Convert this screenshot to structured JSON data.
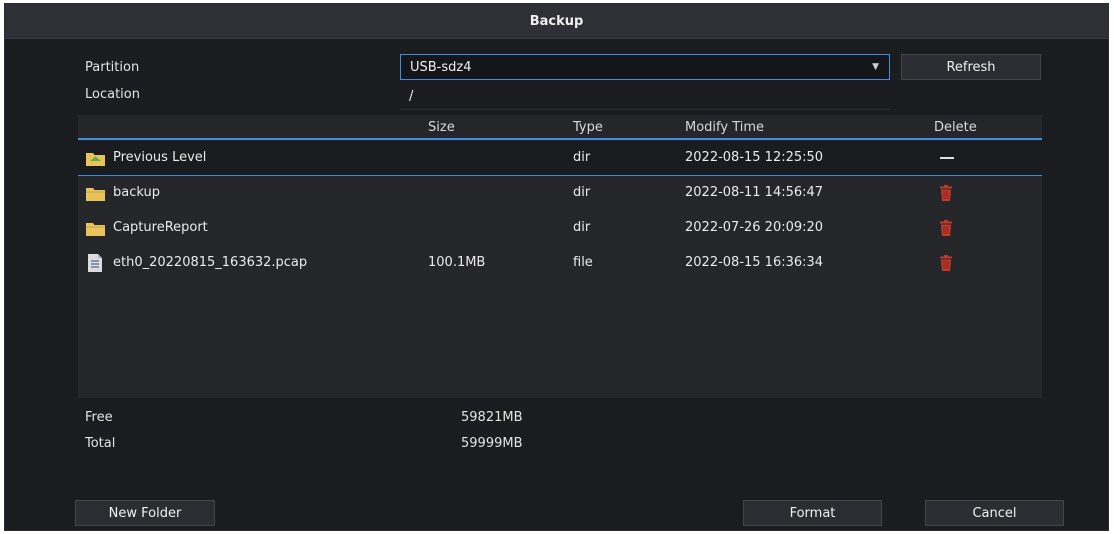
{
  "window": {
    "title": "Backup"
  },
  "form": {
    "partition_label": "Partition",
    "partition_value": "USB-sdz4",
    "location_label": "Location",
    "location_value": "/",
    "refresh_button": "Refresh"
  },
  "table": {
    "columns": [
      "",
      "Size",
      "Type",
      "Modify Time",
      "Delete"
    ],
    "rows": [
      {
        "name": "Previous Level",
        "size": "",
        "type": "dir",
        "time": "2022-08-15 12:25:50",
        "icon": "folder-up-icon",
        "delete": "dash-icon"
      },
      {
        "name": "backup",
        "size": "",
        "type": "dir",
        "time": "2022-08-11 14:56:47",
        "icon": "folder-icon",
        "delete": "trash-icon"
      },
      {
        "name": "CaptureReport",
        "size": "",
        "type": "dir",
        "time": "2022-07-26 20:09:20",
        "icon": "folder-icon",
        "delete": "trash-icon"
      },
      {
        "name": "eth0_20220815_163632.pcap",
        "size": "100.1MB",
        "type": "file",
        "time": "2022-08-15 16:36:34",
        "icon": "file-icon",
        "delete": "trash-icon"
      }
    ]
  },
  "storage": {
    "free_label": "Free",
    "free_value": "59821MB",
    "total_label": "Total",
    "total_value": "59999MB"
  },
  "buttons": {
    "new_folder": "New Folder",
    "format": "Format",
    "cancel": "Cancel"
  },
  "colors": {
    "accent": "#3f8de0",
    "folder": "#e8c25a",
    "trash": "#c0392b",
    "background": "#1b1c1f"
  }
}
